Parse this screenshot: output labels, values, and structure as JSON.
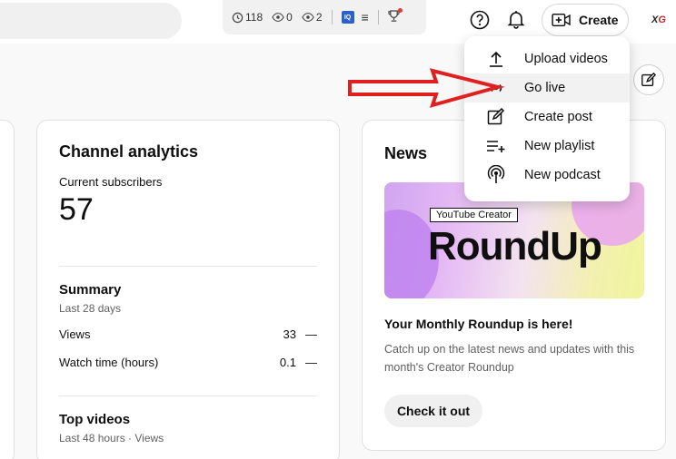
{
  "topbar": {
    "extension": {
      "clock_count": "118",
      "eye1_count": "0",
      "eye2_count": "2",
      "iq_label": "IQ"
    },
    "create_label": "Create",
    "avatar_text": "X",
    "avatar_text_accent": "G"
  },
  "dropdown": {
    "items": [
      {
        "label": "Upload videos",
        "icon": "upload-icon"
      },
      {
        "label": "Go live",
        "icon": "live-icon"
      },
      {
        "label": "Create post",
        "icon": "post-edit-icon"
      },
      {
        "label": "New playlist",
        "icon": "playlist-add-icon"
      },
      {
        "label": "New podcast",
        "icon": "podcast-icon"
      }
    ],
    "hovered_index": 1
  },
  "analytics": {
    "title": "Channel analytics",
    "subscribers_label": "Current subscribers",
    "subscribers_value": "57",
    "summary_title": "Summary",
    "summary_period": "Last 28 days",
    "metrics": [
      {
        "label": "Views",
        "value": "33",
        "trend": "—"
      },
      {
        "label": "Watch time (hours)",
        "value": "0.1",
        "trend": "—"
      }
    ],
    "top_videos_title": "Top videos",
    "top_videos_period": "Last 48 hours · Views"
  },
  "news": {
    "title": "News",
    "banner_tag": "YouTube Creator",
    "banner_title": "RoundUp",
    "headline": "Your Monthly Roundup is here!",
    "body": "Catch up on the latest news and updates with this month's Creator Roundup",
    "cta_label": "Check it out"
  },
  "colors": {
    "annotation_arrow": "#e02020",
    "iq_badge": "#2a60c8"
  }
}
